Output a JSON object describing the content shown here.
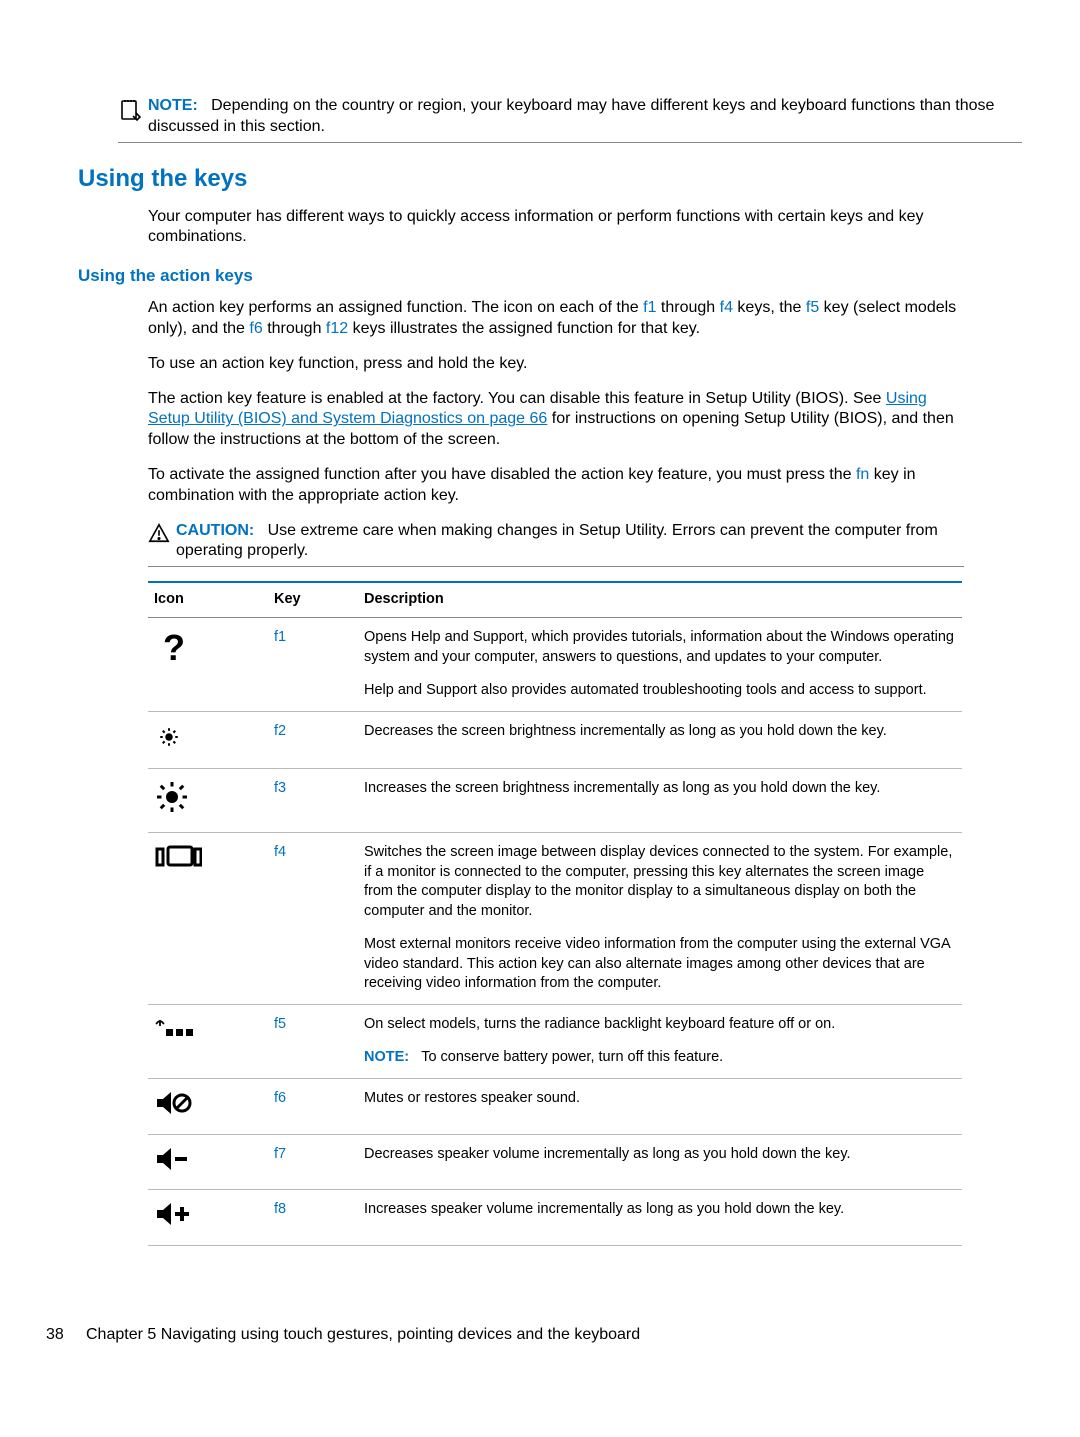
{
  "note": {
    "label": "NOTE:",
    "text": "Depending on the country or region, your keyboard may have different keys and keyboard functions than those discussed in this section."
  },
  "section_heading": "Using the keys",
  "intro": "Your computer has different ways to quickly access information or perform functions with certain keys and key combinations.",
  "subsection_heading": "Using the action keys",
  "p1_pre": "An action key performs an assigned function. The icon on each of the ",
  "p1_f1": "f1",
  "p1_mid1": " through ",
  "p1_f4": "f4",
  "p1_mid2": " keys, the ",
  "p1_f5": "f5",
  "p1_mid3": " key (select models only), and the ",
  "p1_f6": "f6",
  "p1_mid4": " through ",
  "p1_f12": "f12",
  "p1_post": " keys illustrates the assigned function for that key.",
  "p2": "To use an action key function, press and hold the key.",
  "p3_a": "The action key feature is enabled at the factory. You can disable this feature in Setup Utility (BIOS). See ",
  "p3_link": "Using Setup Utility (BIOS) and System Diagnostics on page 66",
  "p3_b": " for instructions on opening Setup Utility (BIOS), and then follow the instructions at the bottom of the screen.",
  "p4_a": "To activate the assigned function after you have disabled the action key feature, you must press the ",
  "p4_fn": "fn",
  "p4_b": " key in combination with the appropriate action key.",
  "caution": {
    "label": "CAUTION:",
    "text": "Use extreme care when making changes in Setup Utility. Errors can prevent the computer from operating properly."
  },
  "table": {
    "headers": {
      "icon": "Icon",
      "key": "Key",
      "desc": "Description"
    },
    "rows": [
      {
        "icon_name": "help-icon",
        "key": "f1",
        "desc": [
          "Opens Help and Support, which provides tutorials, information about the Windows operating system and your computer, answers to questions, and updates to your computer.",
          "Help and Support also provides automated troubleshooting tools and access to support."
        ]
      },
      {
        "icon_name": "brightness-down-icon",
        "key": "f2",
        "desc": [
          "Decreases the screen brightness incrementally as long as you hold down the key."
        ]
      },
      {
        "icon_name": "brightness-up-icon",
        "key": "f3",
        "desc": [
          "Increases the screen brightness incrementally as long as you hold down the key."
        ]
      },
      {
        "icon_name": "switch-display-icon",
        "key": "f4",
        "desc": [
          "Switches the screen image between display devices connected to the system. For example, if a monitor is connected to the computer, pressing this key alternates the screen image from the computer display to the monitor display to a simultaneous display on both the computer and the monitor.",
          "Most external monitors receive video information from the computer using the external VGA video standard. This action key can also alternate images among other devices that are receiving video information from the computer."
        ]
      },
      {
        "icon_name": "keyboard-backlight-icon",
        "key": "f5",
        "desc": [
          "On select models, turns the radiance backlight keyboard feature off or on."
        ],
        "note_label": "NOTE:",
        "note_text": "To conserve battery power, turn off this feature."
      },
      {
        "icon_name": "mute-icon",
        "key": "f6",
        "desc": [
          "Mutes or restores speaker sound."
        ]
      },
      {
        "icon_name": "volume-down-icon",
        "key": "f7",
        "desc": [
          "Decreases speaker volume incrementally as long as you hold down the key."
        ]
      },
      {
        "icon_name": "volume-up-icon",
        "key": "f8",
        "desc": [
          "Increases speaker volume incrementally as long as you hold down the key."
        ]
      }
    ]
  },
  "footer": {
    "page": "38",
    "chapter": "Chapter 5   Navigating using touch gestures, pointing devices and the keyboard"
  }
}
